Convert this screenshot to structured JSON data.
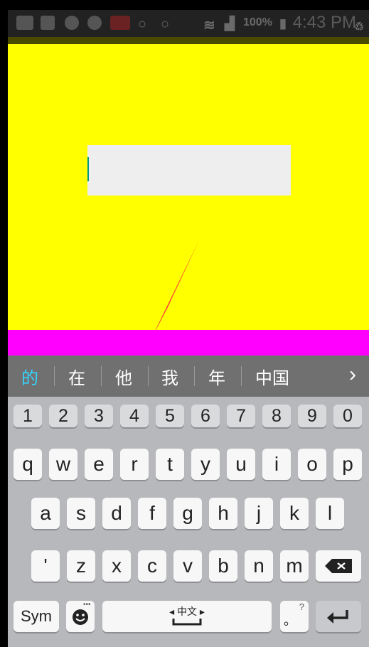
{
  "status_bar": {
    "battery": "100%",
    "time": "4:43 PM",
    "icons": [
      "message-icon",
      "facebook-icon",
      "app-icon",
      "app-icon-2",
      "news-icon",
      "search-icon",
      "search-icon-2",
      "wifi-icon",
      "signal-icon",
      "battery-icon"
    ]
  },
  "app": {
    "background": "#ffff00",
    "input_value": "",
    "accent_bar": "#ff00ff"
  },
  "candidates": {
    "items": [
      "的",
      "在",
      "他",
      "我",
      "年",
      "中国"
    ],
    "more": "›"
  },
  "keyboard": {
    "numbers": [
      "1",
      "2",
      "3",
      "4",
      "5",
      "6",
      "7",
      "8",
      "9",
      "0"
    ],
    "row1": [
      "q",
      "w",
      "e",
      "r",
      "t",
      "y",
      "u",
      "i",
      "o",
      "p"
    ],
    "row2": [
      "a",
      "s",
      "d",
      "f",
      "g",
      "h",
      "j",
      "k",
      "l"
    ],
    "row3": [
      "'",
      "z",
      "x",
      "c",
      "v",
      "b",
      "n",
      "m"
    ],
    "sym_label": "Sym",
    "space_label": "中文",
    "period_label": "。",
    "period_hint": "?",
    "colors": {
      "background": "#b7b8bb",
      "key": "#f7f7f7",
      "candidate_highlight": "#33d6ff"
    }
  }
}
